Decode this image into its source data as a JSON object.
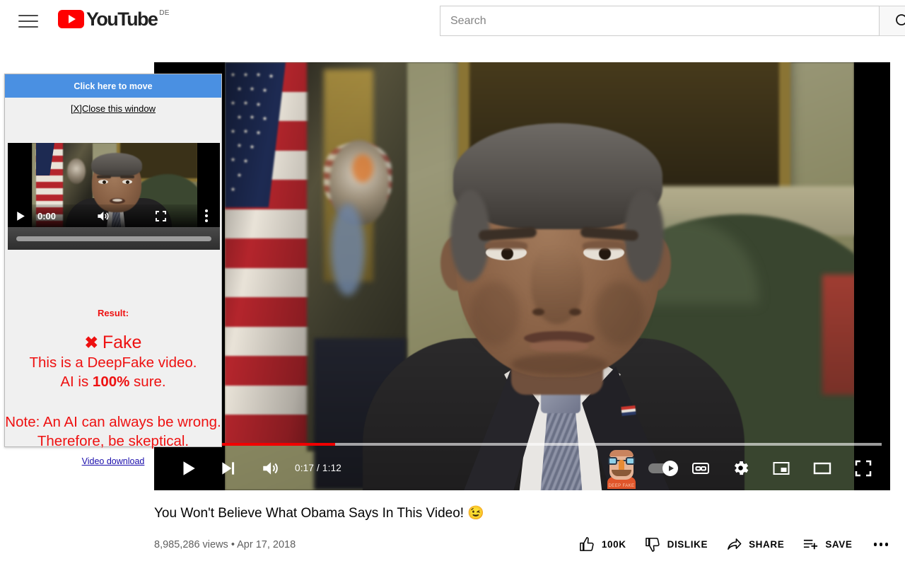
{
  "header": {
    "menu_icon": "hamburger-menu-icon",
    "logo_text": "YouTube",
    "logo_country": "DE",
    "search": {
      "placeholder": "Search",
      "value": "",
      "button_icon": "search-icon"
    }
  },
  "player": {
    "time_current": "0:17",
    "time_total": "1:12",
    "time_display": "0:17 / 1:12",
    "progress_percent": 24,
    "play_icon": "play-icon",
    "next_icon": "next-track-icon",
    "volume_icon": "volume-icon",
    "extension_icon": "deepfake-detector-mascot-icon",
    "extension_icon_label": "DEEP FAKE",
    "autoplay_icon": "autoplay-toggle",
    "autoplay_on": true,
    "captions_icon": "closed-captions-icon",
    "captions_label": "CC",
    "settings_icon": "settings-gear-icon",
    "miniplayer_icon": "miniplayer-icon",
    "theater_icon": "theater-mode-icon",
    "fullscreen_icon": "fullscreen-icon",
    "accent_color": "#f00000"
  },
  "video": {
    "title": "You Won't Believe What Obama Says In This Video! 😉",
    "views": "8,985,286 views",
    "separator": "•",
    "date": "Apr 17, 2018",
    "meta_line": "8,985,286 views • Apr 17, 2018",
    "actions": [
      {
        "label": "100K",
        "icon": "thumbs-up-icon",
        "name": "like-button"
      },
      {
        "label": "DISLIKE",
        "icon": "thumbs-down-icon",
        "name": "dislike-button"
      },
      {
        "label": "SHARE",
        "icon": "share-arrow-icon",
        "name": "share-button"
      },
      {
        "label": "SAVE",
        "icon": "save-playlist-icon",
        "name": "save-button"
      }
    ],
    "more_icon": "more-actions-icon"
  },
  "extension_panel": {
    "header_label": "Click here to move",
    "header_color": "#4a90e2",
    "close_label": "[X]Close this window",
    "mini_player": {
      "time": "0:00",
      "play_icon": "play-icon",
      "volume_icon": "volume-icon",
      "fullscreen_icon": "fullscreen-icon",
      "menu_icon": "kebab-menu-icon"
    },
    "result_label": "Result:",
    "verdict_mark": "✖",
    "verdict": "Fake",
    "line_1": "This is a DeepFake video.",
    "line_2_pre": "AI is ",
    "line_2_bold": "100%",
    "line_2_post": " sure.",
    "note_line_1": "Note: An AI can always be wrong.",
    "note_line_2": "Therefore, be skeptical.",
    "download_label": "Video download",
    "result_color": "#ee1111",
    "link_color": "#1a0dab"
  }
}
